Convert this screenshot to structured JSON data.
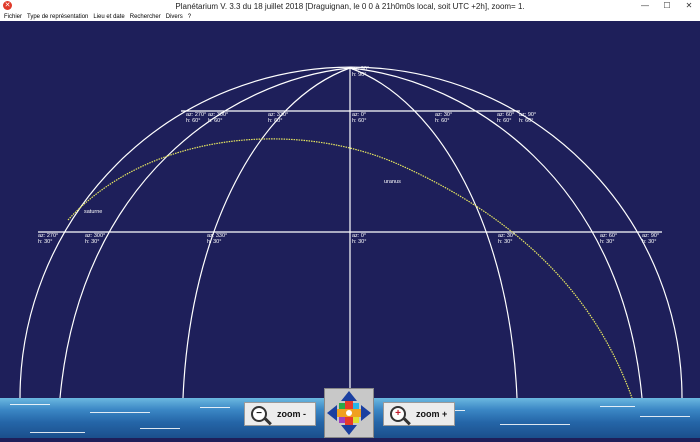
{
  "window": {
    "title": "Planétarium V. 3.3 du 18 juillet 2018 [Draguignan, le 0  0 à 21h0m0s local, soit UTC +2h], zoom= 1.",
    "controls": [
      "—",
      "☐",
      "✕"
    ]
  },
  "menu": [
    "Fichier",
    "Type de représentation",
    "Lieu et date",
    "Rechercher",
    "Divers",
    "?"
  ],
  "colors": {
    "sky": "#1e1f5a",
    "grid": "#ffffff",
    "ecliptic": "#e8e860"
  },
  "zenith": {
    "az": "az: 90°",
    "h": "h: 90°"
  },
  "grid60": [
    {
      "az": "az: 270°",
      "h": "h: 60°"
    },
    {
      "az": "az: 300°",
      "h": "h: 60°"
    },
    {
      "az": "az: 330°",
      "h": "h: 60°"
    },
    {
      "az": "az: 0°",
      "h": "h: 60°"
    },
    {
      "az": "az: 30°",
      "h": "h: 60°"
    },
    {
      "az": "az: 60°",
      "h": "h: 60°"
    },
    {
      "az": "az: 90°",
      "h": "h: 60°"
    }
  ],
  "grid30": [
    {
      "az": "az: 270°",
      "h": "h: 30°"
    },
    {
      "az": "az: 300°",
      "h": "h: 30°"
    },
    {
      "az": "az: 330°",
      "h": "h: 30°"
    },
    {
      "az": "az: 0°",
      "h": "h: 30°"
    },
    {
      "az": "az: 30°",
      "h": "h: 30°"
    },
    {
      "az": "az: 60°",
      "h": "h: 30°"
    },
    {
      "az": "az: 90°",
      "h": "h: 30°"
    }
  ],
  "planets": {
    "saturne": "saturne",
    "uranus": "uranus"
  },
  "zoom": {
    "minus_label": "zoom -",
    "plus_label": "zoom +",
    "minus_sign": "−",
    "plus_sign": "+"
  }
}
